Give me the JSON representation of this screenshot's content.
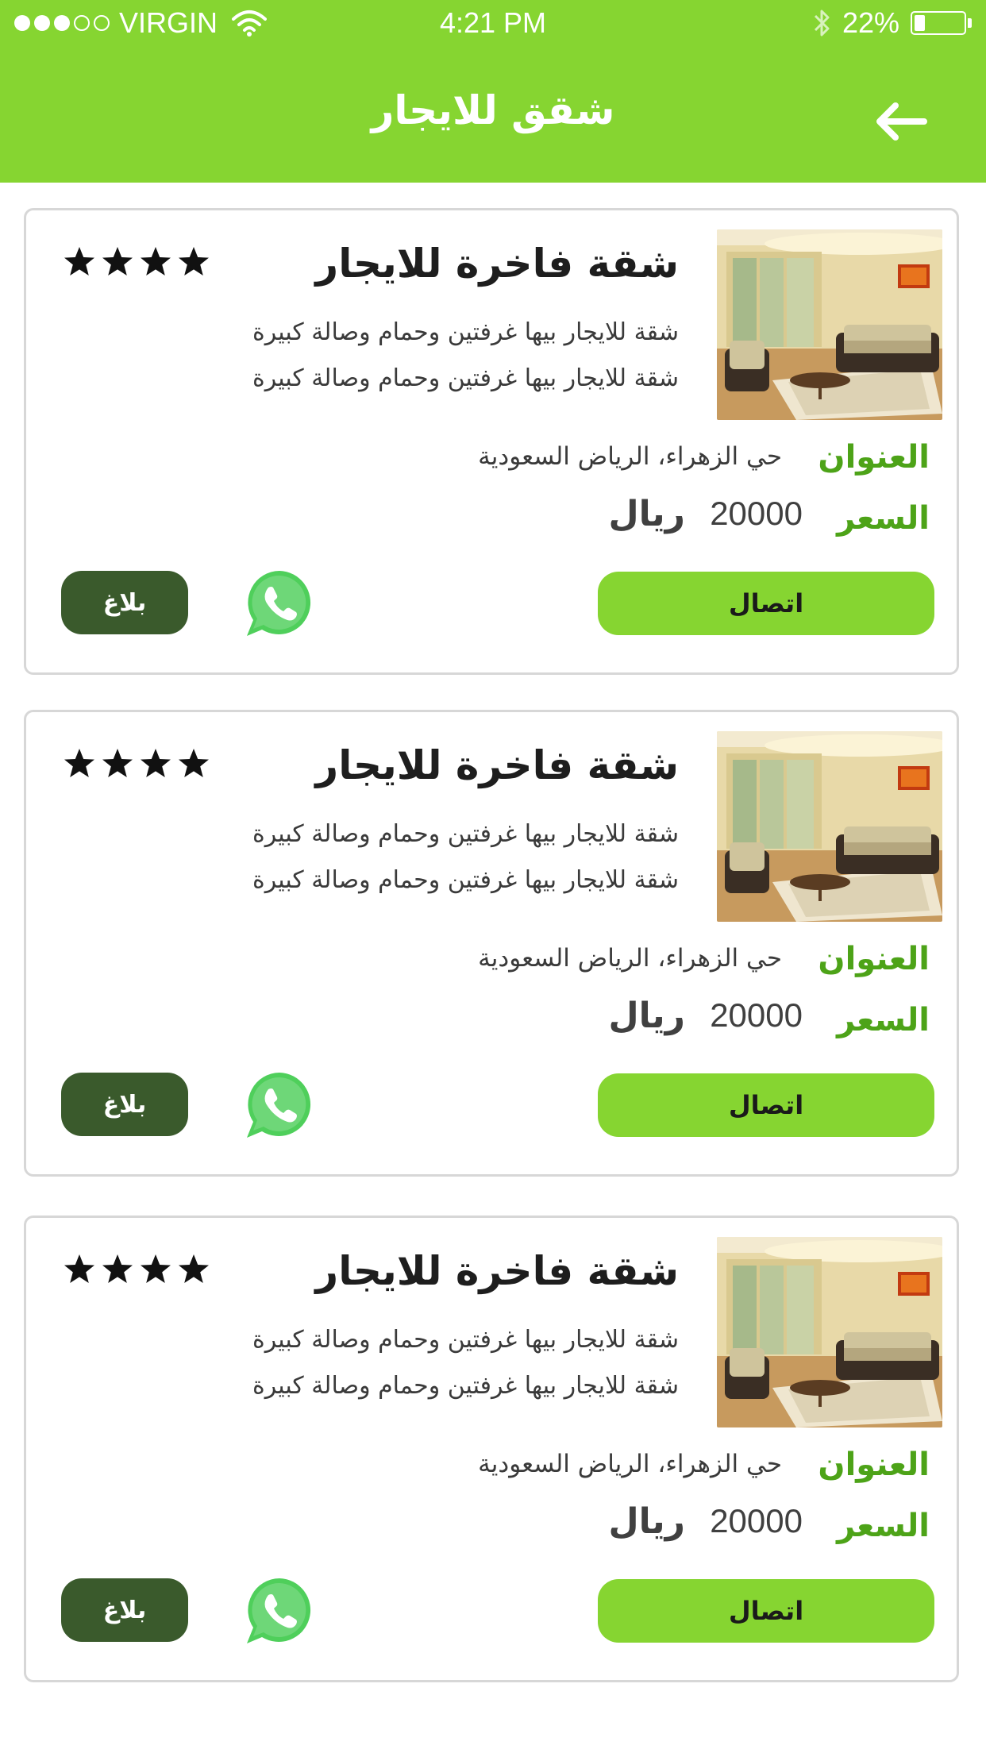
{
  "status_bar": {
    "carrier": "VIRGIN",
    "time": "4:21 PM",
    "battery": "22%",
    "battery_level": 0.22
  },
  "header": {
    "title": "شقق للايجار",
    "back_icon": "arrow-left-icon"
  },
  "listings": [
    {
      "title": "شقة فاخرة للايجار",
      "rating": 4,
      "desc_line1": "شقة  للايجار بيها غرفتين وحمام وصالة كبيرة",
      "desc_line2": "شقة  للايجار بيها غرفتين وحمام وصالة كبيرة",
      "address_label": "العنوان",
      "address": "حي الزهراء، الرياض السعودية",
      "price_label": "السعر",
      "price": "20000",
      "currency": "ريال",
      "call_label": "اتصال",
      "report_label": "بلاغ"
    },
    {
      "title": "شقة فاخرة للايجار",
      "rating": 4,
      "desc_line1": "شقة  للايجار بيها غرفتين وحمام وصالة كبيرة",
      "desc_line2": "شقة  للايجار بيها غرفتين وحمام وصالة كبيرة",
      "address_label": "العنوان",
      "address": "حي الزهراء، الرياض السعودية",
      "price_label": "السعر",
      "price": "20000",
      "currency": "ريال",
      "call_label": "اتصال",
      "report_label": "بلاغ"
    },
    {
      "title": "شقة فاخرة للايجار",
      "rating": 4,
      "desc_line1": "شقة  للايجار بيها غرفتين وحمام وصالة كبيرة",
      "desc_line2": "شقة  للايجار بيها غرفتين وحمام وصالة كبيرة",
      "address_label": "العنوان",
      "address": "حي الزهراء، الرياض السعودية",
      "price_label": "السعر",
      "price": "20000",
      "currency": "ريال",
      "call_label": "اتصال",
      "report_label": "بلاغ"
    }
  ],
  "colors": {
    "brand_green": "#86d531",
    "label_green": "#4da318",
    "report_dark_green": "#3a5a2c",
    "whatsapp_green": "#4fcf5b"
  }
}
